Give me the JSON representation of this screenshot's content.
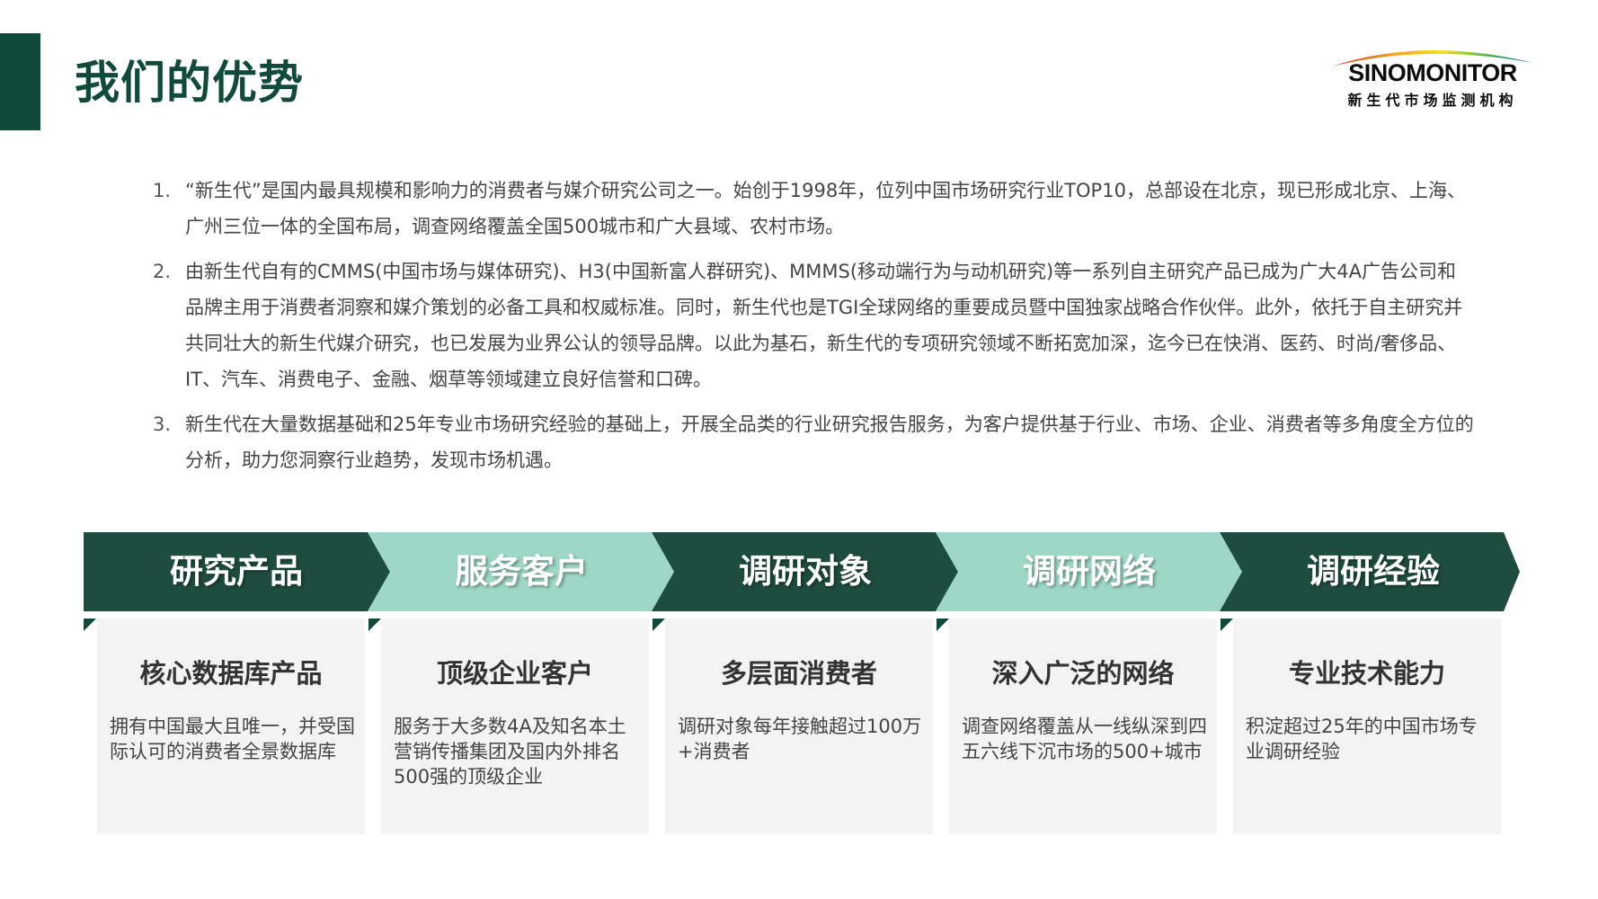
{
  "page": {
    "title": "我们的优势"
  },
  "logo": {
    "wordmark": "SINOMONITOR",
    "subtitle": "新生代市场监测机构"
  },
  "points": [
    {
      "num": "1.",
      "text": "“新生代”是国内最具规模和影响力的消费者与媒介研究公司之一。始创于1998年，位列中国市场研究行业TOP10，总部设在北京，现已形成北京、上海、广州三位一体的全国布局，调查网络覆盖全国500城市和广大县域、农村市场。"
    },
    {
      "num": "2.",
      "text": "由新生代自有的CMMS(中国市场与媒体研究)、H3(中国新富人群研究)、MMMS(移动端行为与动机研究)等一系列自主研究产品已成为广大4A广告公司和品牌主用于消费者洞察和媒介策划的必备工具和权威标准。同时，新生代也是TGI全球网络的重要成员暨中国独家战略合作伙伴。此外，依托于自主研究并共同壮大的新生代媒介研究，也已发展为业界公认的领导品牌。以此为基石，新生代的专项研究领域不断拓宽加深，迄今已在快消、医药、时尚/奢侈品、IT、汽车、消费电子、金融、烟草等领域建立良好信誉和口碑。"
    },
    {
      "num": "3.",
      "text": "新生代在大量数据基础和25年专业市场研究经验的基础上，开展全品类的行业研究报告服务，为客户提供基于行业、市场、企业、消费者等多角度全方位的分析，助力您洞察行业趋势，发现市场机遇。"
    }
  ],
  "colors": {
    "dark_green": "#1e4d3f",
    "mint": "#9ed7c6",
    "title_green": "#0f4a3a",
    "card_bg": "#f3f3f3"
  },
  "pillars": [
    {
      "heading": "研究产品",
      "style": "dark",
      "card_title": "核心数据库产品",
      "card_text": "拥有中国最大且唯一，并受国际认可的消费者全景数据库"
    },
    {
      "heading": "服务客户",
      "style": "mint",
      "card_title": "顶级企业客户",
      "card_text": "服务于大多数4A及知名本土营销传播集团及国内外排名500强的顶级企业"
    },
    {
      "heading": "调研对象",
      "style": "dark",
      "card_title": "多层面消费者",
      "card_text": "调研对象每年接触超过100万+消费者"
    },
    {
      "heading": "调研网络",
      "style": "mint",
      "card_title": "深入广泛的网络",
      "card_text": "调查网络覆盖从一线纵深到四五六线下沉市场的500+城市"
    },
    {
      "heading": "调研经验",
      "style": "dark",
      "card_title": "专业技术能力",
      "card_text": "积淀超过25年的中国市场专业调研经验"
    }
  ]
}
